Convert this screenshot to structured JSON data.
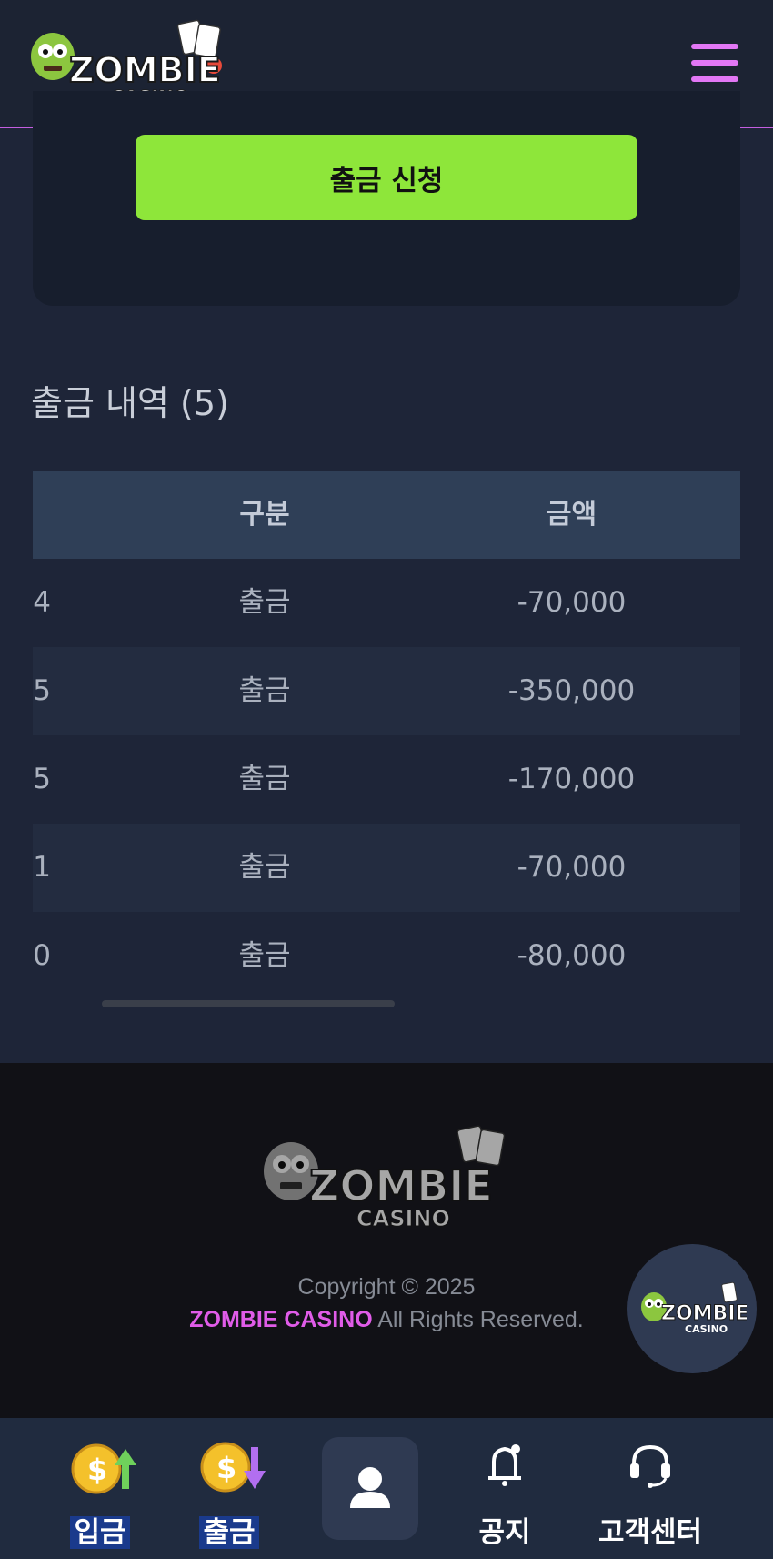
{
  "header": {
    "logo_text_main": "ZOMBIE",
    "logo_text_sub": "CASINO"
  },
  "withdraw": {
    "apply_label": "출금 신청"
  },
  "history": {
    "title": "출금 내역 (5)",
    "columns": [
      "구분",
      "금액"
    ],
    "rows": [
      {
        "partial": "4",
        "type": "출금",
        "amount": "-70,000"
      },
      {
        "partial": "5",
        "type": "출금",
        "amount": "-350,000"
      },
      {
        "partial": "5",
        "type": "출금",
        "amount": "-170,000"
      },
      {
        "partial": "1",
        "type": "출금",
        "amount": "-70,000"
      },
      {
        "partial": "0",
        "type": "출금",
        "amount": "-80,000"
      }
    ]
  },
  "footer": {
    "copyright": "Copyright © 2025",
    "brand": "ZOMBIE CASINO",
    "rights": " All Rights Reserved."
  },
  "nav": {
    "deposit": "입금",
    "withdraw": "출금",
    "notice": "공지",
    "support": "고객센터"
  },
  "colors": {
    "accent": "#e277f5",
    "apply_button": "#8ee63a",
    "brand_text": "#e05ce8"
  }
}
